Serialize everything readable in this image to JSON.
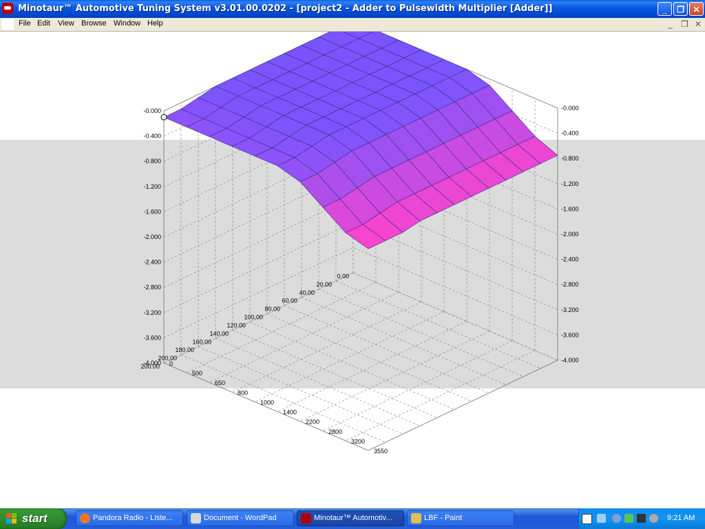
{
  "window": {
    "title": "Minotaur™ Automotive Tuning System  v3.01.00.0202 - [project2 - Adder to Pulsewidth Multiplier [Adder]]",
    "minimize_glyph": "_",
    "restore_glyph": "❐",
    "close_glyph": "✕"
  },
  "menu": {
    "items": [
      "File",
      "Edit",
      "View",
      "Browse",
      "Window",
      "Help"
    ],
    "mdi_minimize": "_",
    "mdi_restore": "❐",
    "mdi_close": "✕"
  },
  "chart_data": {
    "type": "surface3d",
    "z_ticks": [
      "-0.000",
      "-0.400",
      "-0.800",
      "-1.200",
      "-1.600",
      "-2.000",
      "-2.400",
      "-2.800",
      "-3.200",
      "-3.600",
      "-4.000"
    ],
    "zlim": [
      -4.0,
      0.0
    ],
    "x_ticks": [
      "0.00",
      "20.00",
      "40.00",
      "60.00",
      "80.00",
      "100.00",
      "120.00",
      "140.00",
      "160.00",
      "180.00",
      "200.00",
      "200.00"
    ],
    "y_ticks": [
      "0",
      "500",
      "650",
      "800",
      "1000",
      "1400",
      "2200",
      "2800",
      "3200",
      "3550"
    ],
    "grid": true,
    "colors": {
      "low": "#7a55ff",
      "high": "#ff44cc"
    },
    "surface": {
      "description_rows": "x index 0..11 along left axis, y index 0..9 along right axis",
      "values": [
        [
          0,
          0,
          0,
          0,
          0,
          0,
          -0.1,
          -0.35,
          -0.6,
          -0.75
        ],
        [
          0,
          0,
          0,
          0,
          0,
          0,
          -0.1,
          -0.35,
          -0.6,
          -0.75
        ],
        [
          0,
          0,
          0,
          0,
          0,
          0,
          -0.1,
          -0.35,
          -0.6,
          -0.75
        ],
        [
          0,
          0,
          0,
          0,
          0,
          0,
          -0.1,
          -0.35,
          -0.6,
          -0.75
        ],
        [
          0,
          0,
          0,
          0,
          0,
          0,
          -0.1,
          -0.35,
          -0.6,
          -0.75
        ],
        [
          0,
          0,
          0,
          0,
          0,
          0,
          -0.1,
          -0.35,
          -0.6,
          -0.75
        ],
        [
          0,
          0,
          0,
          0,
          0,
          0,
          -0.1,
          -0.35,
          -0.6,
          -0.75
        ],
        [
          0,
          0,
          0,
          0,
          0,
          0,
          -0.1,
          -0.35,
          -0.6,
          -0.75
        ],
        [
          0,
          0,
          0,
          0,
          0,
          0,
          -0.1,
          -0.35,
          -0.6,
          -0.75
        ],
        [
          -0.05,
          -0.05,
          -0.05,
          -0.05,
          -0.05,
          -0.05,
          -0.15,
          -0.4,
          -0.65,
          -0.8
        ],
        [
          -0.1,
          -0.1,
          -0.1,
          -0.1,
          -0.1,
          -0.1,
          -0.2,
          -0.45,
          -0.7,
          -0.8
        ],
        [
          -0.1,
          -0.1,
          -0.1,
          -0.1,
          -0.1,
          -0.1,
          -0.2,
          -0.45,
          -0.7,
          -0.8
        ]
      ]
    }
  },
  "taskbar": {
    "start_label": "start",
    "tasks": [
      {
        "label": "Pandora Radio - Liste...",
        "icon": "firefox-icon",
        "color": "#e8762b"
      },
      {
        "label": "Document - WordPad",
        "icon": "wordpad-icon",
        "color": "#d8d8d8"
      },
      {
        "label": "Minotaur™ Automotiv...",
        "icon": "minotaur-icon",
        "color": "#b00000"
      },
      {
        "label": "LBF - Paint",
        "icon": "paint-icon",
        "color": "#e0c050"
      }
    ],
    "tray_icons": [
      "help-icon",
      "network-icon",
      "back-icon",
      "volume-icon",
      "fn-icon",
      "sound-icon"
    ],
    "clock": "9:21 AM"
  }
}
